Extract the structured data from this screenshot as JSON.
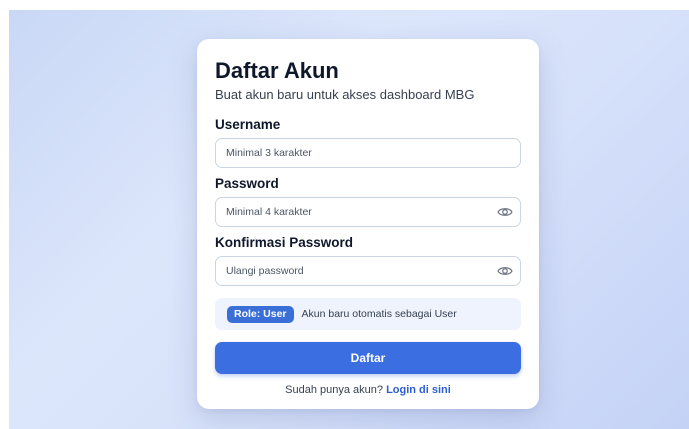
{
  "form": {
    "title": "Daftar Akun",
    "subtitle": "Buat akun baru untuk akses dashboard MBG",
    "username": {
      "label": "Username",
      "value": "",
      "placeholder": "Minimal 3 karakter"
    },
    "password": {
      "label": "Password",
      "value": "",
      "placeholder": "Minimal 4 karakter",
      "toggle_icon": "eye-icon"
    },
    "confirm_password": {
      "label": "Konfirmasi Password",
      "value": "",
      "placeholder": "Ulangi password",
      "toggle_icon": "eye-icon"
    },
    "role": {
      "badge": "Role: User",
      "note": "Akun baru otomatis sebagai User"
    },
    "submit_label": "Daftar",
    "footer": {
      "prompt": "Sudah punya akun? ",
      "link": "Login di sini"
    }
  },
  "colors": {
    "accent": "#3b6ee0",
    "badge": "#3b6fd8",
    "link": "#2d5fd3",
    "role_box_bg": "#eef3fd"
  }
}
